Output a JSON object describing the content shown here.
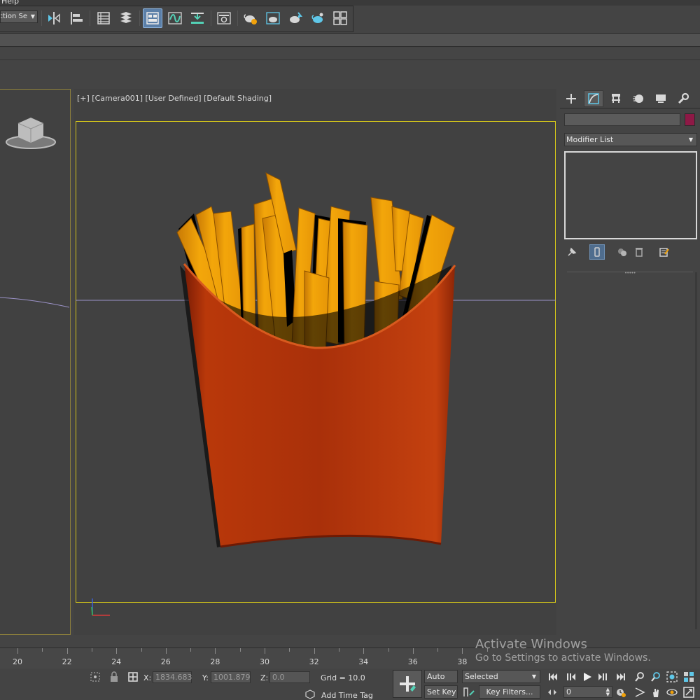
{
  "menu": {
    "help_label": "Help"
  },
  "toolbar": {
    "selection_set_value": "ction Se",
    "icons": [
      "mirror-icon",
      "align-icon",
      "scene-explorer-icon",
      "layer-explorer-icon",
      "toggle-ribbon-icon",
      "curve-editor-icon",
      "dope-sheet-icon",
      "schematic-view-icon",
      "material-editor-icon",
      "render-setup-icon",
      "rendered-frame-window-icon",
      "render-production-icon",
      "render-iterative-icon"
    ]
  },
  "viewport": {
    "label": "[+] [Camera001] [User Defined] [Default Shading]",
    "object_colors": {
      "fries": "#f0a10a",
      "carton": "#c23c0a",
      "safe_frame": "#d4c51a",
      "horizon": "#9c93c9"
    }
  },
  "command_panel": {
    "tabs": [
      "create-tab-icon",
      "modify-tab-icon",
      "hierarchy-tab-icon",
      "motion-tab-icon",
      "display-tab-icon",
      "utilities-tab-icon"
    ],
    "object_name": "",
    "object_color": "#8e1946",
    "modifier_list_label": "Modifier List"
  },
  "timeline": {
    "ticks": [
      "20",
      "22",
      "24",
      "26",
      "28",
      "30",
      "32",
      "34",
      "36",
      "38"
    ]
  },
  "status": {
    "x_label": "X:",
    "x_value": "1834.683",
    "y_label": "Y:",
    "y_value": "1001.879",
    "z_label": "Z:",
    "z_value": "0.0",
    "grid_text": "Grid = 10.0",
    "add_time_tag": "Add Time Tag",
    "auto_key": "Auto Key",
    "set_key": "Set Key",
    "key_mode": "Selected",
    "key_filters": "Key Filters...",
    "current_frame": "0"
  },
  "watermark": {
    "line1": "Activate Windows",
    "line2": "Go to Settings to activate Windows."
  }
}
